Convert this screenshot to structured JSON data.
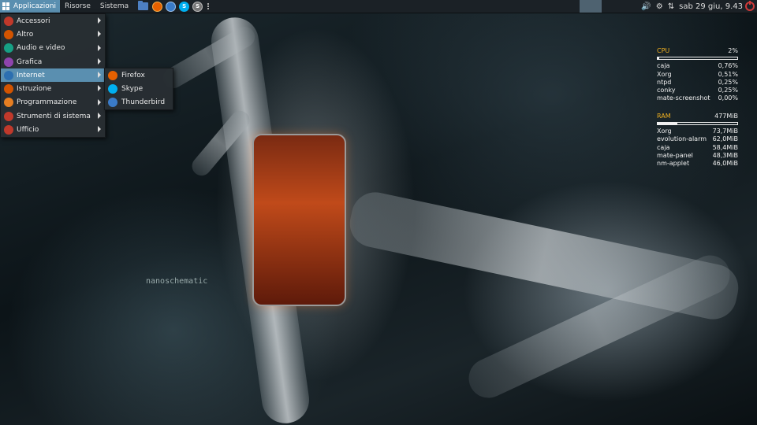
{
  "panel": {
    "applications_label": "Applicazioni",
    "places_label": "Risorse",
    "system_label": "Sistema",
    "launchers": [
      {
        "icon": "folder-icon"
      },
      {
        "icon": "firefox-icon"
      },
      {
        "icon": "thunderbird-icon"
      },
      {
        "icon": "skype-icon"
      },
      {
        "icon": "screenshot-icon"
      }
    ],
    "clock": "sab 29 giu,  9.43",
    "tray_icons": [
      "volume-icon",
      "settings-icon",
      "network-icon",
      "power-icon"
    ]
  },
  "menu": {
    "items": [
      {
        "label": "Accessori",
        "icon": "accessories-icon",
        "color": "#c0392b"
      },
      {
        "label": "Altro",
        "icon": "other-icon",
        "color": "#d35400"
      },
      {
        "label": "Audio e video",
        "icon": "multimedia-icon",
        "color": "#16a085"
      },
      {
        "label": "Grafica",
        "icon": "graphics-icon",
        "color": "#8e44ad"
      },
      {
        "label": "Internet",
        "icon": "internet-icon",
        "color": "#2c6fb0"
      },
      {
        "label": "Istruzione",
        "icon": "education-icon",
        "color": "#d35400"
      },
      {
        "label": "Programmazione",
        "icon": "development-icon",
        "color": "#e67e22"
      },
      {
        "label": "Strumenti di sistema",
        "icon": "system-tools-icon",
        "color": "#c0392b"
      },
      {
        "label": "Ufficio",
        "icon": "office-icon",
        "color": "#c0392b"
      }
    ],
    "active_index": 4
  },
  "submenu": {
    "items": [
      {
        "label": "Firefox",
        "icon": "firefox-icon",
        "color": "#e66000"
      },
      {
        "label": "Skype",
        "icon": "skype-icon",
        "color": "#00aff0"
      },
      {
        "label": "Thunderbird",
        "icon": "thunderbird-icon",
        "color": "#3a7bc8"
      }
    ]
  },
  "conky": {
    "cpu": {
      "label": "CPU",
      "value": "2%",
      "percent": 2,
      "processes": [
        {
          "name": "caja",
          "value": "0,76%"
        },
        {
          "name": "Xorg",
          "value": "0,51%"
        },
        {
          "name": "ntpd",
          "value": "0,25%"
        },
        {
          "name": "conky",
          "value": "0,25%"
        },
        {
          "name": "mate-screenshot",
          "value": "0,00%"
        }
      ]
    },
    "ram": {
      "label": "RAM",
      "value": "477MiB",
      "percent": 25,
      "processes": [
        {
          "name": "Xorg",
          "value": "73,7MiB"
        },
        {
          "name": "evolution-alarm",
          "value": "62,0MiB"
        },
        {
          "name": "caja",
          "value": "58,4MiB"
        },
        {
          "name": "mate-panel",
          "value": "48,3MiB"
        },
        {
          "name": "nm-applet",
          "value": "46,0MiB"
        }
      ]
    }
  },
  "wallpaper": {
    "brand_text": "nanoschematic"
  },
  "colors": {
    "accent": "#5a8fb0",
    "panel_bg": "#1b2126",
    "conky_header": "#f0b020",
    "power": "#d03a3a"
  }
}
